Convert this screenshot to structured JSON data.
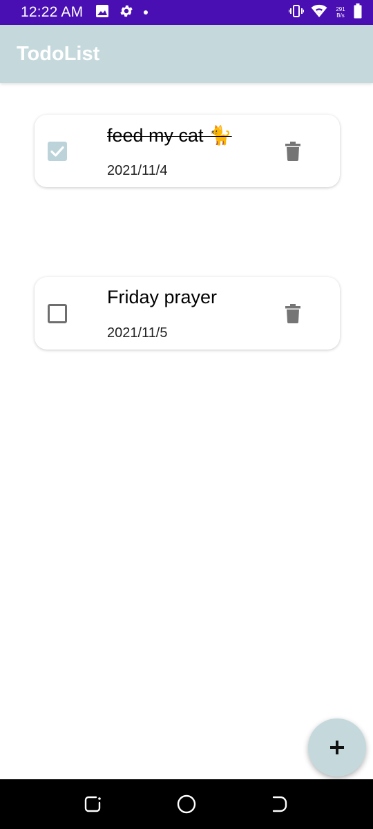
{
  "status_bar": {
    "time": "12:22 AM",
    "net_speed_value": "291",
    "net_speed_unit": "B/s",
    "icons": [
      "image-icon",
      "gear-icon",
      "dot-icon",
      "vibrate-icon",
      "wifi-icon",
      "battery-icon"
    ]
  },
  "app_bar": {
    "title": "TodoList"
  },
  "todos": [
    {
      "title": "feed my cat 🐈",
      "date": "2021/11/4",
      "completed": true
    },
    {
      "title": "Friday prayer",
      "date": "2021/11/5",
      "completed": false
    }
  ],
  "fab": {
    "icon": "plus-icon"
  },
  "nav_bar": {
    "icons": [
      "recent-apps-icon",
      "home-icon",
      "back-icon"
    ]
  },
  "colors": {
    "status_bar": "#4a0fb3",
    "app_bar": "#c5d9dd",
    "checkbox_checked": "#bcd3d9",
    "icon_gray": "#757575"
  }
}
